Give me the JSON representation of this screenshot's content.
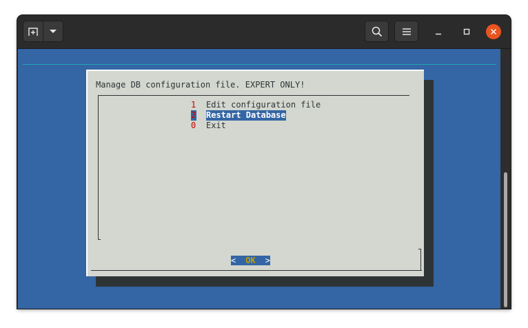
{
  "dialog": {
    "title": "Manage DB configuration file. EXPERT ONLY!",
    "menu": [
      {
        "tag": "1",
        "label": "Edit configuration file",
        "selected": false
      },
      {
        "tag": "2",
        "label": "Restart Database",
        "selected": true
      },
      {
        "tag": "0",
        "label": "Exit",
        "selected": false
      }
    ],
    "ok_button": {
      "left": "<",
      "label": "OK",
      "right": ">"
    }
  },
  "colors": {
    "terminal_bg": "#3465a4",
    "dialog_bg": "#d3d7cf",
    "tag_red": "#cc0000",
    "ok_label": "#c4a000",
    "close_button": "#e95420"
  },
  "icons": {
    "new_tab": "new-tab-icon",
    "dropdown": "chevron-down-icon",
    "search": "search-icon",
    "menu": "hamburger-menu-icon",
    "minimize": "minimize-icon",
    "maximize": "maximize-icon",
    "close": "close-icon"
  }
}
